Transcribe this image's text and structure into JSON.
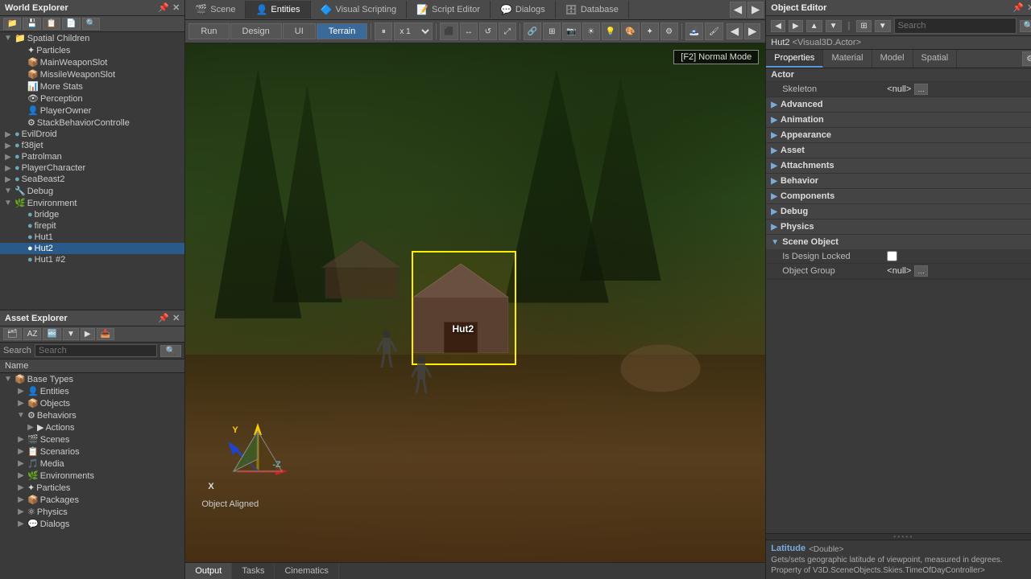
{
  "app": {
    "title": "World Explorer",
    "right_panel_title": "Object Editor"
  },
  "top_tabs": [
    {
      "id": "scene",
      "label": "Scene",
      "icon": "🎬"
    },
    {
      "id": "entities",
      "label": "Entities",
      "icon": "👤"
    },
    {
      "id": "visual_scripting",
      "label": "Visual Scripting",
      "icon": "🔷"
    },
    {
      "id": "script_editor",
      "label": "Script Editor",
      "icon": "📝"
    },
    {
      "id": "dialogs",
      "label": "Dialogs",
      "icon": "💬"
    },
    {
      "id": "database",
      "label": "Database",
      "icon": "🗄"
    }
  ],
  "scene_tabs": [
    {
      "id": "run",
      "label": "Run"
    },
    {
      "id": "design",
      "label": "Design"
    },
    {
      "id": "ui",
      "label": "UI"
    },
    {
      "id": "terrain",
      "label": "Terrain"
    }
  ],
  "viewport": {
    "badge": "[F2] Normal Mode",
    "selected_object": "Hut2",
    "axis_x_label": "X",
    "axis_y_label": "Y",
    "axis_z_label": "-Z",
    "gizmo_label": "Object Aligned"
  },
  "bottom_tabs": [
    {
      "id": "output",
      "label": "Output"
    },
    {
      "id": "tasks",
      "label": "Tasks"
    },
    {
      "id": "cinematics",
      "label": "Cinematics"
    }
  ],
  "world_explorer": {
    "title": "World Explorer",
    "toolbar_buttons": [
      "📁",
      "💾",
      "📋",
      "📄",
      "🔍"
    ],
    "tree": [
      {
        "label": "Spatial Children",
        "level": 0,
        "expanded": true,
        "icon": "📁"
      },
      {
        "label": "Particles",
        "level": 1,
        "icon": "✨"
      },
      {
        "label": "MainWeaponSlot",
        "level": 1,
        "icon": "📦"
      },
      {
        "label": "MissileWeaponSlot",
        "level": 1,
        "icon": "📦"
      },
      {
        "label": "More Stats",
        "level": 1,
        "icon": "📊"
      },
      {
        "label": "Perception",
        "level": 1,
        "icon": "👁"
      },
      {
        "label": "PlayerOwner",
        "level": 1,
        "icon": "👤"
      },
      {
        "label": "StackBehaviorController",
        "level": 1,
        "icon": "⚙"
      },
      {
        "label": "EvilDroid",
        "level": 0,
        "icon": "🤖"
      },
      {
        "label": "f38jet",
        "level": 0,
        "icon": "✈"
      },
      {
        "label": "Patrolman",
        "level": 0,
        "icon": "👤"
      },
      {
        "label": "PlayerCharacter",
        "level": 0,
        "icon": "👤"
      },
      {
        "label": "SeaBeast2",
        "level": 0,
        "icon": "🐉"
      },
      {
        "label": "Debug",
        "level": 0,
        "expanded": true,
        "icon": "🔧"
      },
      {
        "label": "Environment",
        "level": 0,
        "expanded": true,
        "icon": "🌿"
      },
      {
        "label": "bridge",
        "level": 1,
        "icon": "🔗"
      },
      {
        "label": "firepit",
        "level": 1,
        "icon": "🔥"
      },
      {
        "label": "Hut1",
        "level": 1,
        "icon": "🏠"
      },
      {
        "label": "Hut2",
        "level": 1,
        "icon": "🏠",
        "selected": true
      },
      {
        "label": "Hut1 #2",
        "level": 1,
        "icon": "🏠"
      }
    ]
  },
  "asset_explorer": {
    "title": "Asset Explorer",
    "search_placeholder": "Search",
    "search_label": "Search",
    "col_name": "Name",
    "tree": [
      {
        "label": "Base Types",
        "level": 0,
        "expanded": true,
        "icon": "📦"
      },
      {
        "label": "Entities",
        "level": 1,
        "icon": "👤"
      },
      {
        "label": "Objects",
        "level": 1,
        "icon": "📦"
      },
      {
        "label": "Behaviors",
        "level": 1,
        "expanded": true,
        "icon": "⚙"
      },
      {
        "label": "Actions",
        "level": 2,
        "icon": "▶"
      },
      {
        "label": "Scenes",
        "level": 1,
        "icon": "🎬"
      },
      {
        "label": "Scenarios",
        "level": 1,
        "icon": "📋"
      },
      {
        "label": "Media",
        "level": 1,
        "icon": "🎵"
      },
      {
        "label": "Environments",
        "level": 1,
        "icon": "🌿"
      },
      {
        "label": "Particles",
        "level": 1,
        "icon": "✨"
      },
      {
        "label": "Packages",
        "level": 1,
        "icon": "📦"
      },
      {
        "label": "Physics",
        "level": 1,
        "icon": "⚛"
      },
      {
        "label": "Dialogs",
        "level": 1,
        "icon": "💬"
      }
    ]
  },
  "object_editor": {
    "title": "Object Editor",
    "selected_object": "Hut2",
    "selected_type": "<Visual3D.Actor>",
    "tabs": [
      {
        "id": "properties",
        "label": "Properties"
      },
      {
        "id": "material",
        "label": "Material"
      },
      {
        "id": "model",
        "label": "Model"
      },
      {
        "id": "spatial",
        "label": "Spatial"
      }
    ],
    "toolbar": {
      "nav_back": "◀",
      "nav_fwd": "▶",
      "search_placeholder": "Search"
    },
    "actor_section": {
      "label": "Actor",
      "skeleton_label": "Skeleton",
      "skeleton_value": "<null>"
    },
    "properties": [
      {
        "label": "Advanced",
        "type": "group"
      },
      {
        "label": "Animation",
        "type": "group"
      },
      {
        "label": "Appearance",
        "type": "group"
      },
      {
        "label": "Asset",
        "type": "group"
      },
      {
        "label": "Attachments",
        "type": "group"
      },
      {
        "label": "Behavior",
        "type": "group"
      },
      {
        "label": "Components",
        "type": "group"
      },
      {
        "label": "Debug",
        "type": "group"
      },
      {
        "label": "Physics",
        "type": "group"
      },
      {
        "label": "Scene Object",
        "type": "group",
        "expanded": true,
        "children": [
          {
            "label": "Is Design Locked",
            "type": "checkbox",
            "value": false
          },
          {
            "label": "Object Group",
            "type": "text",
            "value": "<null>"
          }
        ]
      }
    ],
    "bottom": {
      "title": "Latitude",
      "type": "<Double>",
      "description": "Gets/sets geographic latitude of viewpoint, measured in degrees. Property of V3D.SceneObjects.Skies.TimeOfDayController>"
    }
  }
}
